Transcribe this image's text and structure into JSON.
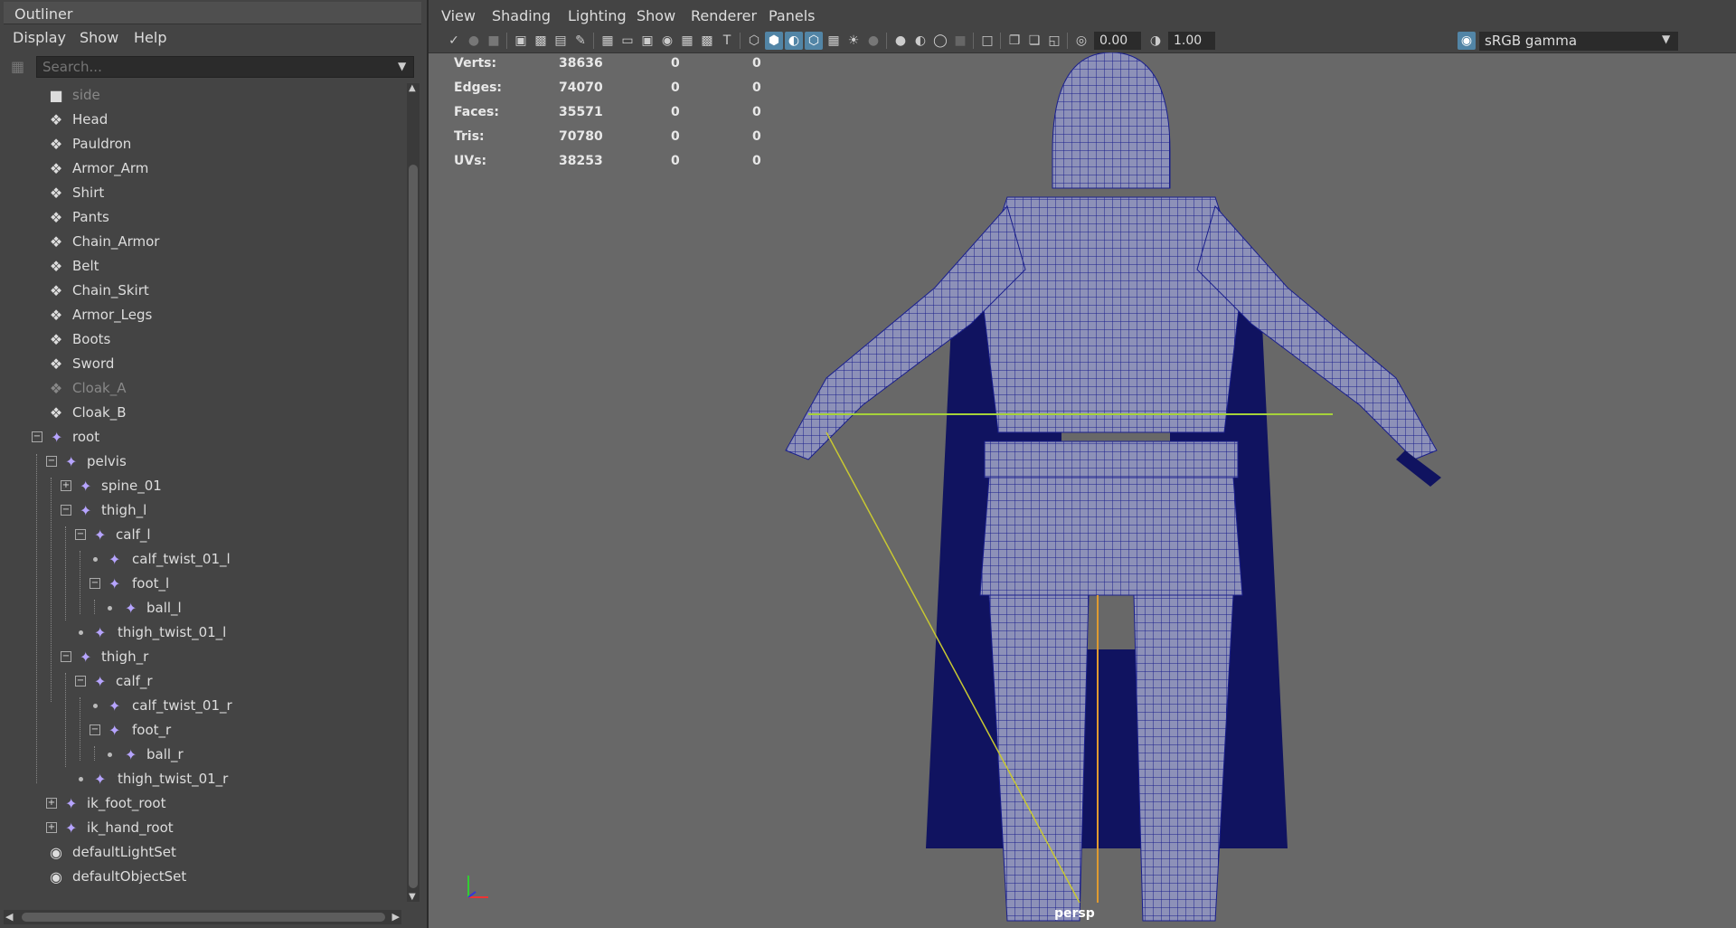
{
  "outliner": {
    "title": "Outliner",
    "menu": [
      "Display",
      "Show",
      "Help"
    ],
    "search_placeholder": "Search..."
  },
  "tree": [
    {
      "label": "side",
      "type": "camera",
      "dim": true
    },
    {
      "label": "Head",
      "type": "mesh"
    },
    {
      "label": "Pauldron",
      "type": "mesh"
    },
    {
      "label": "Armor_Arm",
      "type": "mesh"
    },
    {
      "label": "Shirt",
      "type": "mesh"
    },
    {
      "label": "Pants",
      "type": "mesh"
    },
    {
      "label": "Chain_Armor",
      "type": "mesh"
    },
    {
      "label": "Belt",
      "type": "mesh"
    },
    {
      "label": "Chain_Skirt",
      "type": "mesh"
    },
    {
      "label": "Armor_Legs",
      "type": "mesh"
    },
    {
      "label": "Boots",
      "type": "mesh"
    },
    {
      "label": "Sword",
      "type": "mesh"
    },
    {
      "label": "Cloak_A",
      "type": "mesh",
      "dim": true
    },
    {
      "label": "Cloak_B",
      "type": "mesh"
    },
    {
      "label": "root",
      "type": "joint"
    },
    {
      "label": "pelvis",
      "type": "joint"
    },
    {
      "label": "spine_01",
      "type": "joint"
    },
    {
      "label": "thigh_l",
      "type": "joint"
    },
    {
      "label": "calf_l",
      "type": "joint"
    },
    {
      "label": "calf_twist_01_l",
      "type": "joint"
    },
    {
      "label": "foot_l",
      "type": "joint"
    },
    {
      "label": "ball_l",
      "type": "joint"
    },
    {
      "label": "thigh_twist_01_l",
      "type": "joint"
    },
    {
      "label": "thigh_r",
      "type": "joint"
    },
    {
      "label": "calf_r",
      "type": "joint"
    },
    {
      "label": "calf_twist_01_r",
      "type": "joint"
    },
    {
      "label": "foot_r",
      "type": "joint"
    },
    {
      "label": "ball_r",
      "type": "joint"
    },
    {
      "label": "thigh_twist_01_r",
      "type": "joint"
    },
    {
      "label": "ik_foot_root",
      "type": "joint"
    },
    {
      "label": "ik_hand_root",
      "type": "joint"
    },
    {
      "label": "defaultLightSet",
      "type": "set"
    },
    {
      "label": "defaultObjectSet",
      "type": "set"
    }
  ],
  "viewport": {
    "menu": [
      "View",
      "Shading",
      "Lighting",
      "Show",
      "Renderer",
      "Panels"
    ],
    "exposure": "0.00",
    "gamma": "1.00",
    "color_space": "sRGB gamma",
    "camera_label": "persp"
  },
  "hud": {
    "rows": [
      {
        "label": "Verts:",
        "a": "38636",
        "b": "0",
        "c": "0"
      },
      {
        "label": "Edges:",
        "a": "74070",
        "b": "0",
        "c": "0"
      },
      {
        "label": "Faces:",
        "a": "35571",
        "b": "0",
        "c": "0"
      },
      {
        "label": "Tris:",
        "a": "70780",
        "b": "0",
        "c": "0"
      },
      {
        "label": "UVs:",
        "a": "38253",
        "b": "0",
        "c": "0"
      }
    ]
  },
  "colors": {
    "wireframe": "#1a1f8c",
    "mesh_fill": "#8d91b8",
    "selection_green": "#a6d23a",
    "joint_icon": "#b6a4ff",
    "active_button": "#5285a6"
  }
}
